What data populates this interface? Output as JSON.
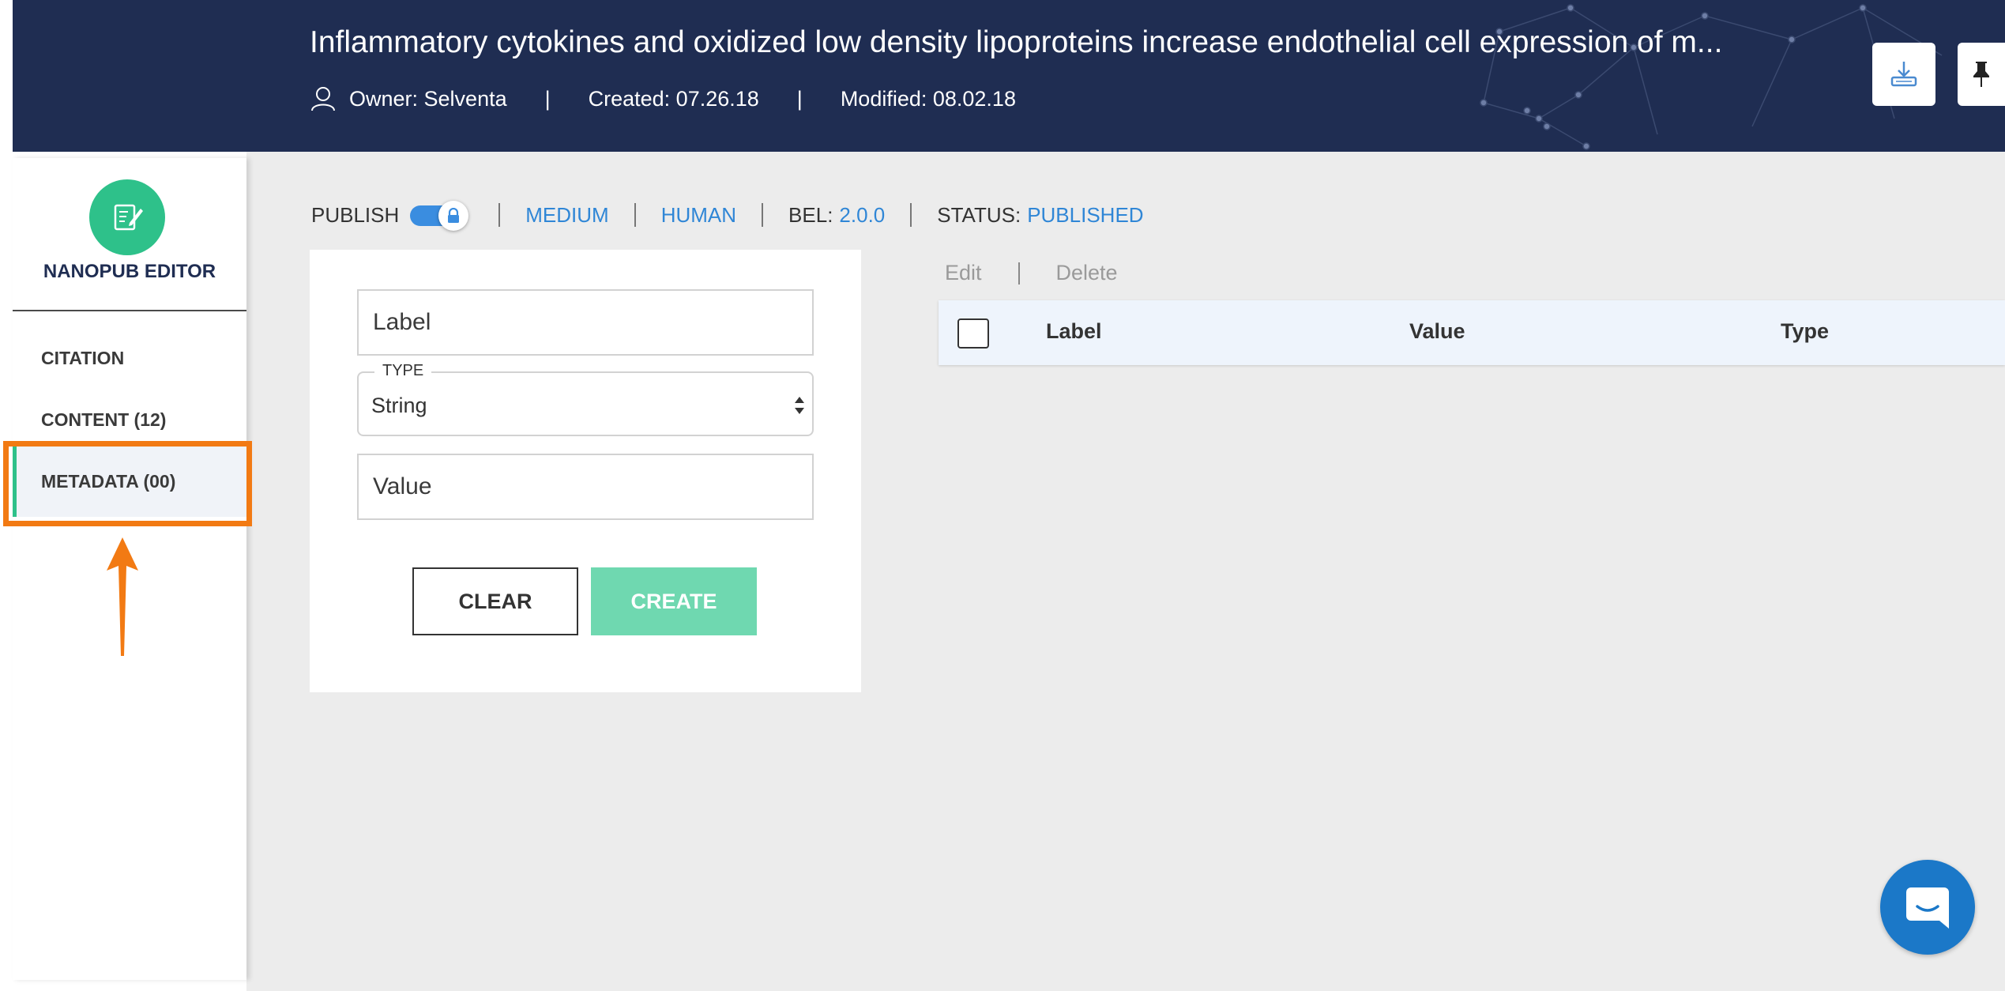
{
  "header": {
    "title": "Inflammatory cytokines and oxidized low density lipoproteins increase endothelial cell expression of m...",
    "owner": "Owner: Selventa",
    "created": "Created: 07.26.18",
    "modified": "Modified: 08.02.18",
    "separator": "|",
    "background_color": "#1f2d52"
  },
  "sidebar": {
    "title": "NANOPUB EDITOR",
    "items": [
      {
        "label": "CITATION"
      },
      {
        "label": "CONTENT (12)"
      },
      {
        "label": "METADATA (00)",
        "active": true
      }
    ],
    "accent_color": "#2ec18a"
  },
  "toolbar": {
    "publish_label": "PUBLISH",
    "publish_on": true,
    "medium": "MEDIUM",
    "human": "HUMAN",
    "bel_label": "BEL:",
    "bel_version": "2.0.0",
    "status_label": "STATUS:",
    "status_value": "PUBLISHED",
    "link_color": "#2f86d6"
  },
  "form": {
    "label_placeholder": "Label",
    "type_legend": "TYPE",
    "type_value": "String",
    "value_placeholder": "Value",
    "clear_label": "CLEAR",
    "create_label": "CREATE"
  },
  "table": {
    "edit_label": "Edit",
    "delete_label": "Delete",
    "columns": [
      "Label",
      "Value",
      "Type"
    ]
  },
  "icons": [
    "user-icon",
    "download-icon",
    "pin-icon",
    "edit-document-icon",
    "lock-icon",
    "chat-icon"
  ],
  "annotation": {
    "color": "#f27a13"
  }
}
